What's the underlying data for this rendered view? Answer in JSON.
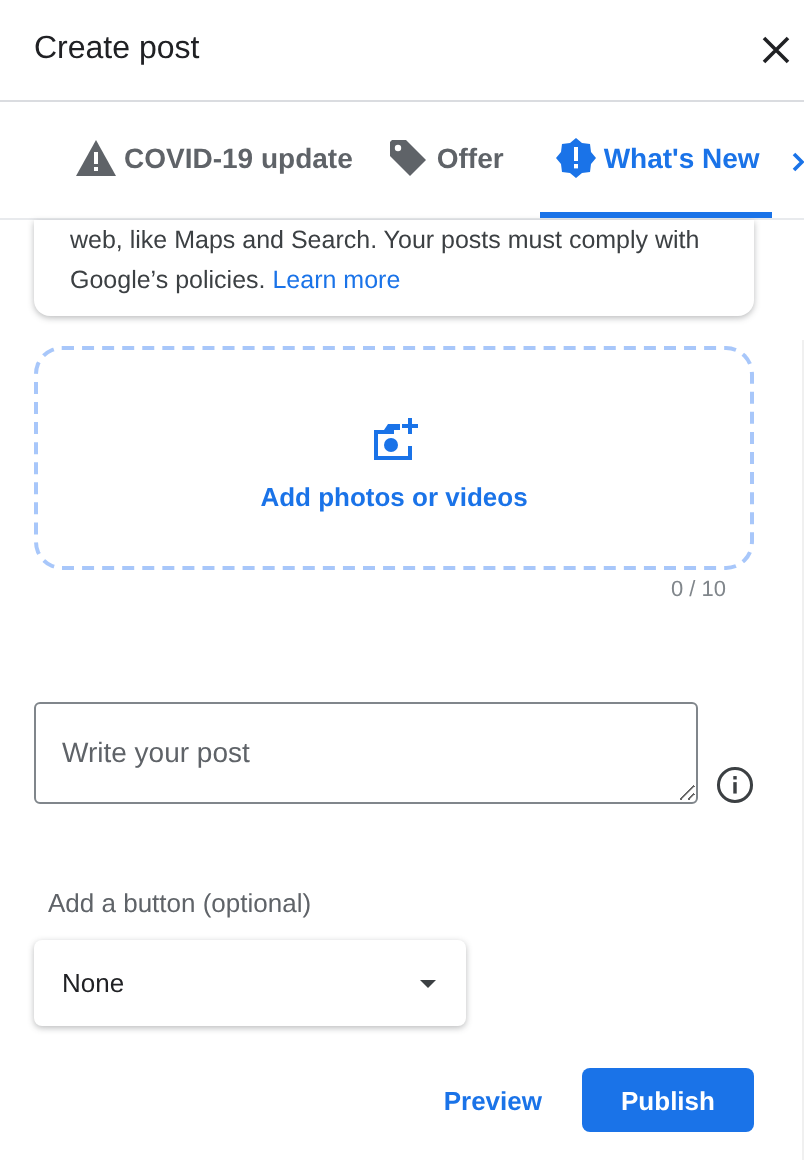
{
  "dialog": {
    "title": "Create post"
  },
  "tabs": [
    {
      "label": "COVID-19 update",
      "kind": "warning",
      "selected": false
    },
    {
      "label": "Offer",
      "kind": "tag",
      "selected": false
    },
    {
      "label": "What's New",
      "kind": "alert",
      "selected": true
    }
  ],
  "notice": {
    "text": "web, like Maps and Search. Your posts must comply with Google’s policies.",
    "link": "Learn more"
  },
  "media": {
    "label": "Add photos or videos",
    "count": "0 / 10"
  },
  "post_field": {
    "placeholder": "Write your post"
  },
  "button_select": {
    "label": "Add a button (optional)",
    "value": "None"
  },
  "actions": {
    "preview": "Preview",
    "publish": "Publish"
  }
}
